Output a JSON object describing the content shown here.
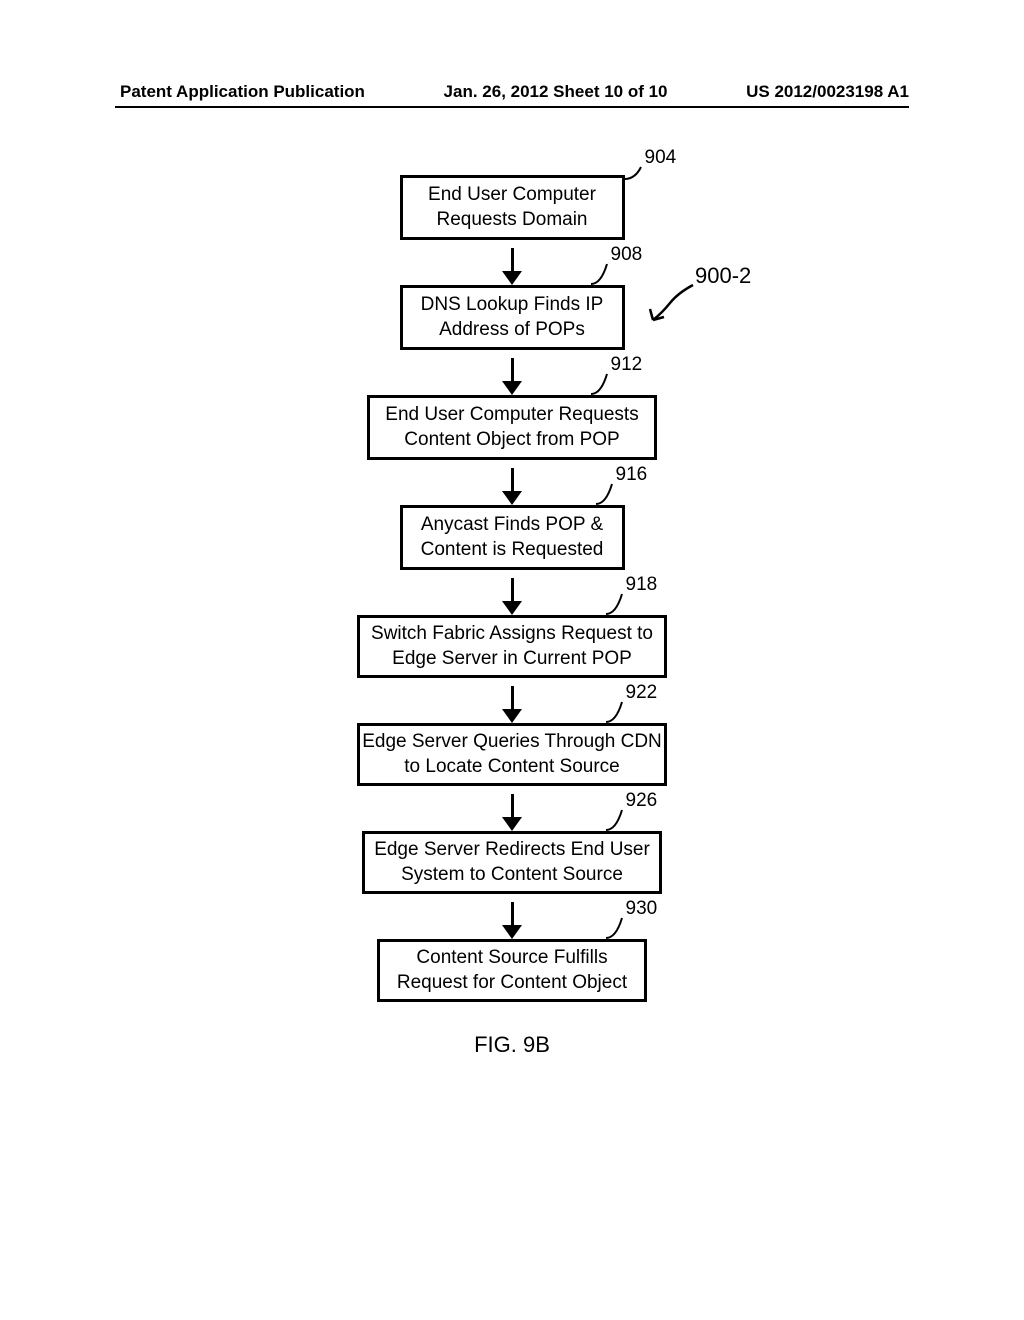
{
  "header": {
    "left": "Patent Application Publication",
    "center": "Jan. 26, 2012  Sheet 10 of 10",
    "right": "US 2012/0023198 A1"
  },
  "diagram_ref": "900-2",
  "chart_data": {
    "type": "flowchart",
    "title": "FIG. 9B",
    "nodes": [
      {
        "ref": "904",
        "label": "End User Computer Requests Domain"
      },
      {
        "ref": "908",
        "label": "DNS Lookup Finds IP Address of POPs"
      },
      {
        "ref": "912",
        "label": "End User Computer Requests Content Object from POP"
      },
      {
        "ref": "916",
        "label": "Anycast Finds POP & Content is Requested"
      },
      {
        "ref": "918",
        "label": "Switch Fabric Assigns Request to Edge Server in Current POP"
      },
      {
        "ref": "922",
        "label": "Edge Server Queries Through CDN to Locate Content Source"
      },
      {
        "ref": "926",
        "label": "Edge Server Redirects End User System to Content Source"
      },
      {
        "ref": "930",
        "label": "Content Source Fulfills Request for Content Object"
      }
    ],
    "edges": [
      {
        "from": "904",
        "to": "908"
      },
      {
        "from": "908",
        "to": "912"
      },
      {
        "from": "912",
        "to": "916"
      },
      {
        "from": "916",
        "to": "918"
      },
      {
        "from": "918",
        "to": "922"
      },
      {
        "from": "922",
        "to": "926"
      },
      {
        "from": "926",
        "to": "930"
      }
    ]
  },
  "figure_label": "FIG. 9B",
  "refs": {
    "r904": "904",
    "r908": "908",
    "r912": "912",
    "r916": "916",
    "r918": "918",
    "r922": "922",
    "r926": "926",
    "r930": "930"
  },
  "box_text": {
    "b904_l1": "End User Computer",
    "b904_l2": "Requests Domain",
    "b908_l1": "DNS Lookup Finds IP",
    "b908_l2": "Address of POPs",
    "b912_l1": "End User Computer Requests",
    "b912_l2": "Content Object from POP",
    "b916_l1": "Anycast Finds POP &",
    "b916_l2": "Content is Requested",
    "b918_l1": "Switch Fabric Assigns Request to",
    "b918_l2": "Edge Server in Current POP",
    "b922_l1": "Edge Server Queries Through CDN",
    "b922_l2": "to Locate Content Source",
    "b926_l1": "Edge Server Redirects End User",
    "b926_l2": "System to Content Source",
    "b930_l1": "Content Source Fulfills",
    "b930_l2": "Request for Content Object"
  }
}
